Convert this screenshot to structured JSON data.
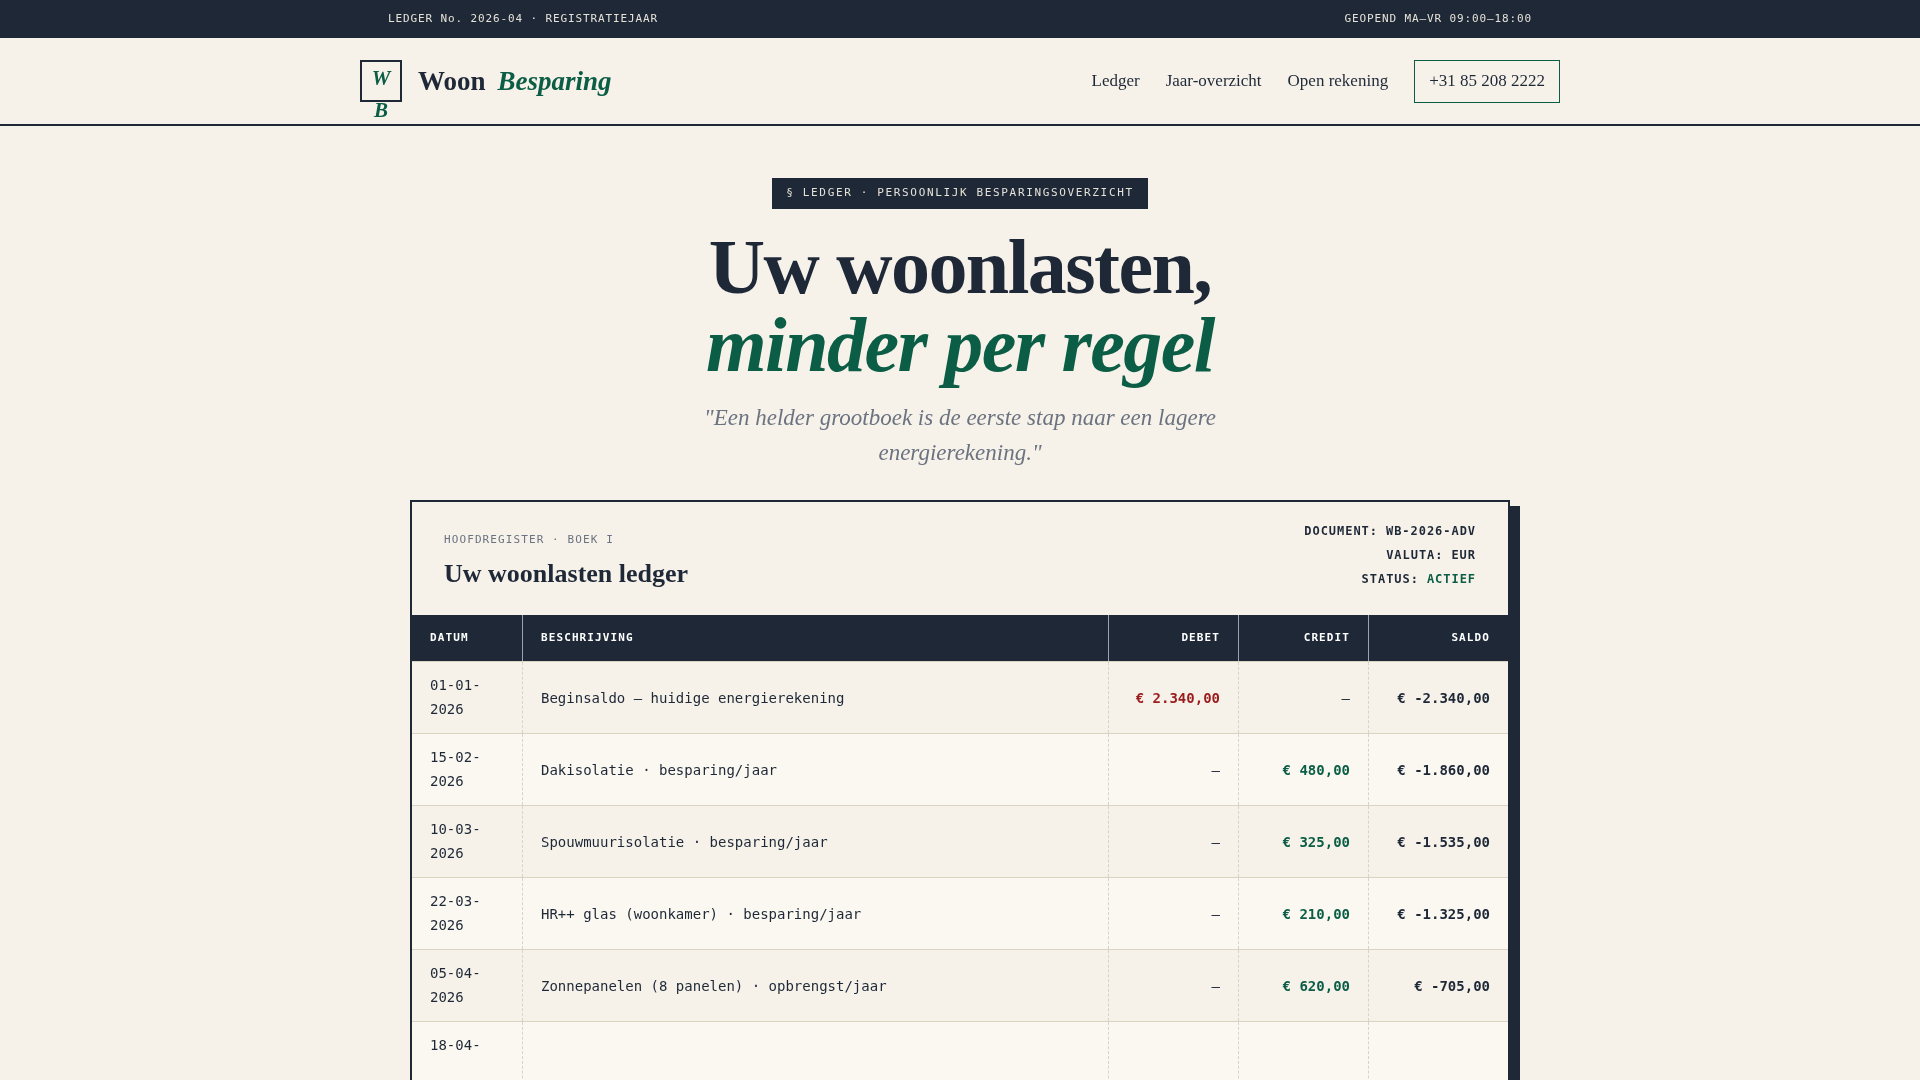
{
  "top_bar": {
    "left": "LEDGER No. 2026-04 · REGISTRATIEJAAR",
    "right": "GEOPEND MA–VR 09:00–18:00"
  },
  "header": {
    "logo_mark": "WB",
    "logo_word": "Woon",
    "logo_accent": "Besparing",
    "nav": [
      "Ledger",
      "Jaar-overzicht",
      "Open rekening"
    ],
    "phone_button": "+31 85 208 2222"
  },
  "hero": {
    "badge": "§ LEDGER · PERSOONLIJK BESPARINGSOVERZICHT",
    "title_line_1": "Uw woonlasten,",
    "title_line_2": "minder per regel",
    "quote": "\"Een helder grootboek is de eerste stap naar een lagere energierekening.\""
  },
  "ledger": {
    "eyebrow": "HOOFDREGISTER · BOEK I",
    "title": "Uw woonlasten ledger",
    "meta": [
      {
        "label": "DOCUMENT:",
        "value": "WB-2026-ADV",
        "kind": "plain"
      },
      {
        "label": "VALUTA:",
        "value": "EUR",
        "kind": "plain"
      },
      {
        "label": "STATUS:",
        "value": "ACTIEF",
        "kind": "status"
      }
    ],
    "table": {
      "columns": [
        "DATUM",
        "BESCHRIJVING",
        "DEBET",
        "CREDIT",
        "SALDO"
      ],
      "rows": [
        {
          "date": "01-01-2026",
          "description": "Beginsaldo — huidige energierekening",
          "debit": "€ 2.340,00",
          "credit": "—",
          "balance": "€ -2.340,00"
        },
        {
          "date": "15-02-2026",
          "description": "Dakisolatie · besparing/jaar",
          "debit": "—",
          "credit": "€ 480,00",
          "balance": "€ -1.860,00"
        },
        {
          "date": "10-03-2026",
          "description": "Spouwmuurisolatie · besparing/jaar",
          "debit": "—",
          "credit": "€ 325,00",
          "balance": "€ -1.535,00"
        },
        {
          "date": "22-03-2026",
          "description": "HR++ glas (woonkamer) · besparing/jaar",
          "debit": "—",
          "credit": "€ 210,00",
          "balance": "€ -1.325,00"
        },
        {
          "date": "05-04-2026",
          "description": "Zonnepanelen (8 panelen) · opbrengst/jaar",
          "debit": "—",
          "credit": "€ 620,00",
          "balance": "€ -705,00"
        },
        {
          "date": "18-04-"
        }
      ]
    }
  }
}
